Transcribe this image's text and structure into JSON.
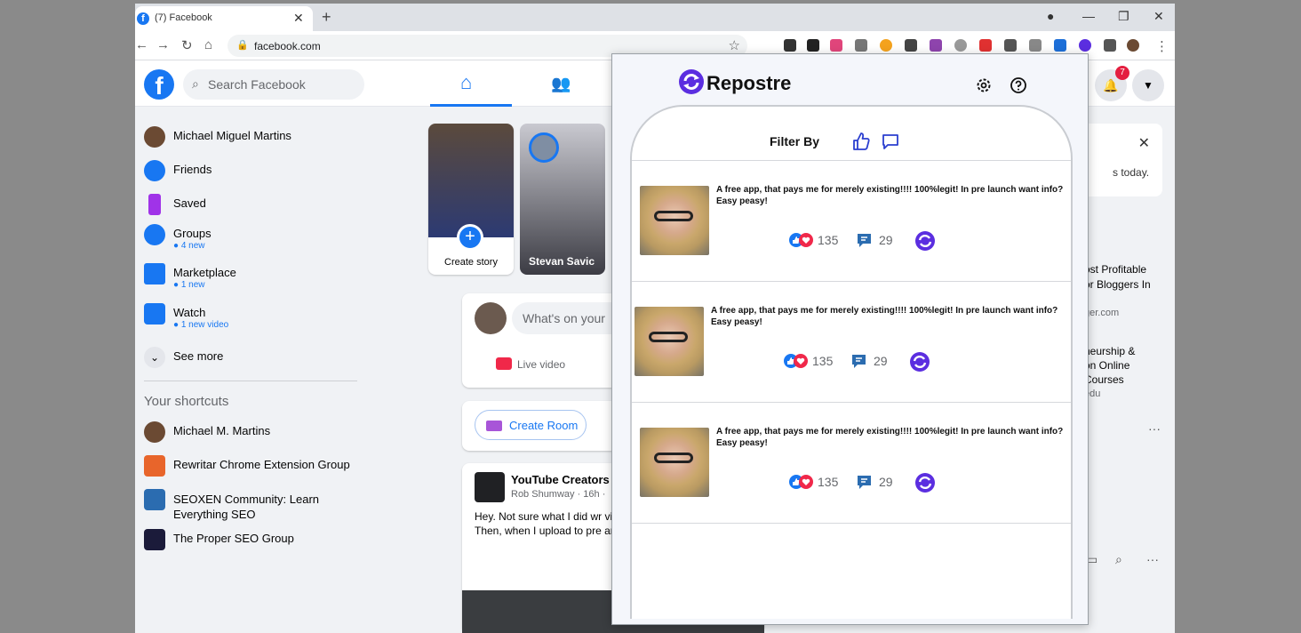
{
  "browser": {
    "tab_title": "(7) Facebook",
    "favicon": "f",
    "url": "facebook.com",
    "new_tab": "+",
    "close_tab": "✕"
  },
  "facebook": {
    "logo": "f",
    "search_placeholder": "Search Facebook",
    "notification_count": "7",
    "sidebar": {
      "items": [
        {
          "label": "Michael Miguel Martins",
          "sub": ""
        },
        {
          "label": "Friends",
          "sub": ""
        },
        {
          "label": "Saved",
          "sub": ""
        },
        {
          "label": "Groups",
          "sub": "● 4 new"
        },
        {
          "label": "Marketplace",
          "sub": "● 1 new"
        },
        {
          "label": "Watch",
          "sub": "● 1 new video"
        },
        {
          "label": "See more",
          "sub": ""
        }
      ],
      "shortcuts_title": "Your shortcuts",
      "shortcuts": [
        {
          "label": "Michael M. Martins"
        },
        {
          "label": "Rewritar Chrome Extension Group"
        },
        {
          "label": "SEOXEN Community: Learn Everything SEO"
        },
        {
          "label": "The Proper SEO Group"
        }
      ]
    },
    "stories": {
      "create_label": "Create story",
      "stevan_label": "Stevan Savic"
    },
    "composer": {
      "placeholder": "What's on your",
      "live_label": "Live video"
    },
    "rooms": {
      "create_label": "Create Room"
    },
    "post": {
      "author": "YouTube Creators",
      "meta": "Rob Shumway · 16h · ",
      "text": "Hey. Not sure what I did wr video clips from the Samsu Then, when I upload to pre anyone tell me what the $ nuts."
    },
    "right": {
      "card_text": "s today.",
      "item1_line1": "ost Profitable",
      "item1_line2": "or Bloggers In",
      "item1_sub": "ger.com",
      "item2_line1": "neurship &",
      "item2_line2": "on Online",
      "item2_line3": "Courses",
      "item2_sub": "edu",
      "more": "···"
    }
  },
  "repostre": {
    "title": "Repostre",
    "filter_label": "Filter By",
    "posts": [
      {
        "text": "A free app, that pays me for merely existing!!!! 100%legit! In pre launch want info? Easy peasy!",
        "likes": "135",
        "comments": "29"
      },
      {
        "text": "A free app, that pays me for merely existing!!!! 100%legit! In pre launch want info? Easy peasy!",
        "likes": "135",
        "comments": "29"
      },
      {
        "text": "A free app, that pays me for merely existing!!!! 100%legit! In pre launch want info? Easy peasy!",
        "likes": "135",
        "comments": "29"
      }
    ],
    "colors": {
      "brand": "#5b2ee0",
      "like": "#1877f2",
      "love": "#f0284a"
    }
  }
}
